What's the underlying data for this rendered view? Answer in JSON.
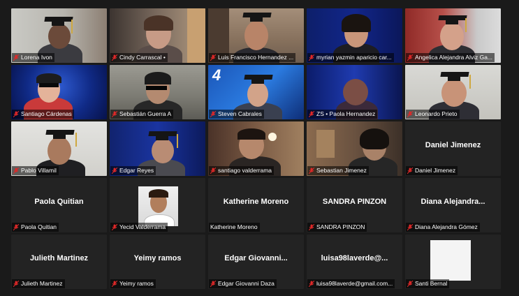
{
  "participants": [
    {
      "name": "Lorena Ivon",
      "muted": true
    },
    {
      "name": "Cindy Carrascal •",
      "muted": true
    },
    {
      "name": "Luis Francisco Hernandez ...",
      "muted": true
    },
    {
      "name": "myrian yazmin aparicio car...",
      "muted": true
    },
    {
      "name": "Angelica Alejandra Alviz Ga...",
      "muted": true
    },
    {
      "name": "Santiago Cárdenas",
      "muted": true
    },
    {
      "name": "Sebastián Guerra A",
      "muted": true
    },
    {
      "name": "Steven Cabrales",
      "muted": true
    },
    {
      "name": "ZS • Paola Hernandez",
      "muted": true
    },
    {
      "name": "Leonardo Prieto",
      "muted": true
    },
    {
      "name": "Pablo Villamil",
      "muted": true
    },
    {
      "name": "Edgar Reyes",
      "muted": true
    },
    {
      "name": "santiago valderrama",
      "muted": true
    },
    {
      "name": "Sebastian Jimenez",
      "muted": true
    },
    {
      "name": "Daniel Jimenez",
      "display": "Daniel Jimenez",
      "muted": true
    },
    {
      "name": "Paola Quitian",
      "display": "Paola Quitian",
      "muted": true
    },
    {
      "name": "Yecid Valderrama",
      "muted": true
    },
    {
      "name": "Katherine Moreno",
      "display": "Katherine Moreno",
      "muted": false
    },
    {
      "name": "SANDRA PINZON",
      "display": "SANDRA PINZON",
      "muted": true
    },
    {
      "name": "Diana Alejandra Gómez",
      "display": "Diana  Alejandra...",
      "muted": true
    },
    {
      "name": "Julieth Martinez",
      "display": "Julieth Martinez",
      "muted": true
    },
    {
      "name": "Yeimy ramos",
      "display": "Yeimy ramos",
      "muted": true
    },
    {
      "name": "Edgar Giovanni Daza",
      "display": "Edgar  Giovanni...",
      "muted": true
    },
    {
      "name": "luisa98laverde@gmail.com...",
      "display": "luisa98laverde@...",
      "muted": true
    },
    {
      "name": "Santi Bernal",
      "muted": true
    }
  ],
  "overlay_text": {
    "tile_8": "4"
  },
  "colors": {
    "mic_muted": "#e02828",
    "background": "#1a1a1a",
    "tile": "#232323"
  }
}
